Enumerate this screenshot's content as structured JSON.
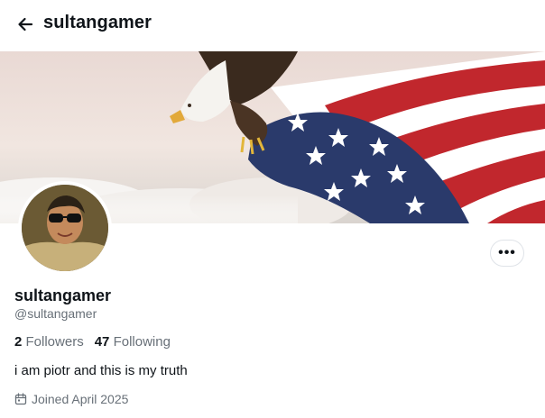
{
  "header": {
    "title": "sultangamer",
    "back_icon": "arrow-left-icon"
  },
  "banner": {
    "description_icon": "banner-image"
  },
  "profile": {
    "display_name": "sultangamer",
    "handle": "@sultangamer",
    "followers_count": "2",
    "followers_label": "Followers",
    "following_count": "47",
    "following_label": "Following",
    "bio": "i am piotr and this is my truth",
    "joined": "Joined April 2025",
    "more_label": "•••"
  },
  "colors": {
    "text": "#0f1419",
    "muted": "#687078",
    "border": "#dfe3e8"
  }
}
